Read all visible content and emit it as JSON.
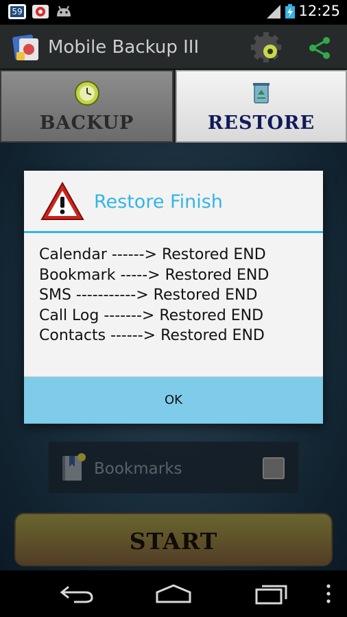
{
  "status_bar": {
    "notification_badge": "59",
    "time": "12:25"
  },
  "action_bar": {
    "title": "Mobile Backup III"
  },
  "tabs": [
    {
      "label": "BACKUP"
    },
    {
      "label": "RESTORE"
    }
  ],
  "main": {
    "bookmark_label": "Bookmarks",
    "start_label": "START"
  },
  "dialog": {
    "title": "Restore Finish",
    "lines": [
      "Calendar ------> Restored END",
      "Bookmark -----> Restored END",
      "SMS -----------> Restored END",
      "Call Log -------> Restored END",
      "Contacts ------> Restored END"
    ],
    "ok_label": "OK"
  },
  "colors": {
    "accent": "#33b5e5",
    "ok_button": "#7fcbea",
    "start_button": "#93823f"
  }
}
